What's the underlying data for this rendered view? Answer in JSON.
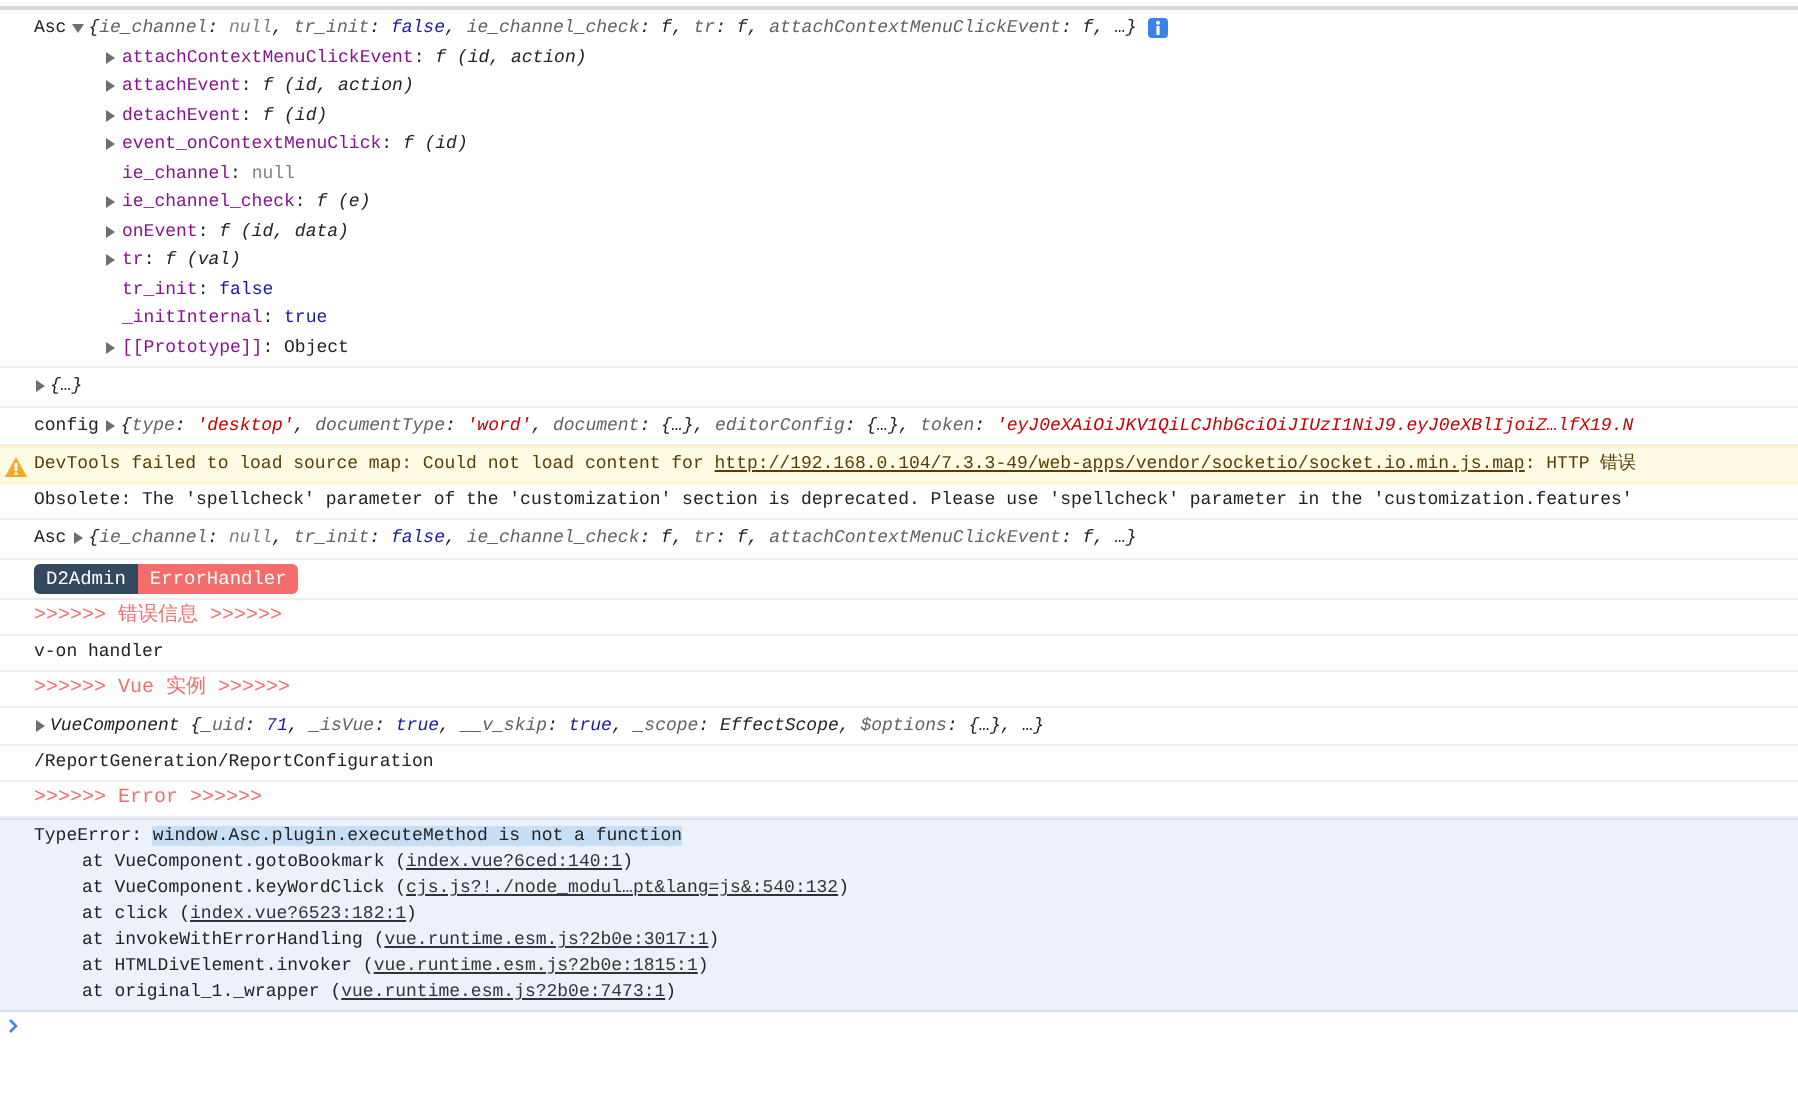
{
  "messages": [
    {
      "kind": "object",
      "label": "Asc",
      "expanded": true,
      "info_icon": true,
      "preview": [
        {
          "kind": "plain",
          "text": "{"
        },
        {
          "kind": "pkey",
          "text": "ie_channel"
        },
        {
          "kind": "plain",
          "text": ": "
        },
        {
          "kind": "null",
          "text": "null"
        },
        {
          "kind": "plain",
          "text": ", "
        },
        {
          "kind": "pkey",
          "text": "tr_init"
        },
        {
          "kind": "plain",
          "text": ": "
        },
        {
          "kind": "bool",
          "text": "false"
        },
        {
          "kind": "plain",
          "text": ", "
        },
        {
          "kind": "pkey",
          "text": "ie_channel_check"
        },
        {
          "kind": "plain",
          "text": ": "
        },
        {
          "kind": "fn",
          "text": "f"
        },
        {
          "kind": "plain",
          "text": ", "
        },
        {
          "kind": "pkey",
          "text": "tr"
        },
        {
          "kind": "plain",
          "text": ": "
        },
        {
          "kind": "fn",
          "text": "f"
        },
        {
          "kind": "plain",
          "text": ", "
        },
        {
          "kind": "pkey",
          "text": "attachContextMenuClickEvent"
        },
        {
          "kind": "plain",
          "text": ": "
        },
        {
          "kind": "fn",
          "text": "f"
        },
        {
          "kind": "plain",
          "text": ", …}"
        }
      ],
      "properties": [
        {
          "expandable": true,
          "parts": [
            {
              "kind": "key",
              "text": "attachContextMenuClickEvent"
            },
            {
              "kind": "plain",
              "text": ": "
            },
            {
              "kind": "fn",
              "text": "f (id, action)"
            }
          ]
        },
        {
          "expandable": true,
          "parts": [
            {
              "kind": "key",
              "text": "attachEvent"
            },
            {
              "kind": "plain",
              "text": ": "
            },
            {
              "kind": "fn",
              "text": "f (id, action)"
            }
          ]
        },
        {
          "expandable": true,
          "parts": [
            {
              "kind": "key",
              "text": "detachEvent"
            },
            {
              "kind": "plain",
              "text": ": "
            },
            {
              "kind": "fn",
              "text": "f (id)"
            }
          ]
        },
        {
          "expandable": true,
          "parts": [
            {
              "kind": "key",
              "text": "event_onContextMenuClick"
            },
            {
              "kind": "plain",
              "text": ": "
            },
            {
              "kind": "fn",
              "text": "f (id)"
            }
          ]
        },
        {
          "expandable": false,
          "parts": [
            {
              "kind": "key",
              "text": "ie_channel"
            },
            {
              "kind": "plain",
              "text": ": "
            },
            {
              "kind": "null",
              "text": "null"
            }
          ]
        },
        {
          "expandable": true,
          "parts": [
            {
              "kind": "key",
              "text": "ie_channel_check"
            },
            {
              "kind": "plain",
              "text": ": "
            },
            {
              "kind": "fn",
              "text": "f (e)"
            }
          ]
        },
        {
          "expandable": true,
          "parts": [
            {
              "kind": "key",
              "text": "onEvent"
            },
            {
              "kind": "plain",
              "text": ": "
            },
            {
              "kind": "fn",
              "text": "f (id, data)"
            }
          ]
        },
        {
          "expandable": true,
          "parts": [
            {
              "kind": "key",
              "text": "tr"
            },
            {
              "kind": "plain",
              "text": ": "
            },
            {
              "kind": "fn",
              "text": "f (val)"
            }
          ]
        },
        {
          "expandable": false,
          "parts": [
            {
              "kind": "key",
              "text": "tr_init"
            },
            {
              "kind": "plain",
              "text": ": "
            },
            {
              "kind": "bool",
              "text": "false"
            }
          ]
        },
        {
          "expandable": false,
          "parts": [
            {
              "kind": "key",
              "text": "_initInternal"
            },
            {
              "kind": "plain",
              "text": ": "
            },
            {
              "kind": "bool",
              "text": "true"
            }
          ]
        },
        {
          "expandable": true,
          "parts": [
            {
              "kind": "key",
              "text": "[[Prototype]]"
            },
            {
              "kind": "plain",
              "text": ": "
            },
            {
              "kind": "plain",
              "text": "Object"
            }
          ]
        }
      ]
    },
    {
      "kind": "object",
      "expanded": false,
      "preview": [
        {
          "kind": "plain",
          "text": "{…}"
        }
      ]
    },
    {
      "kind": "object",
      "label": "config",
      "expanded": false,
      "preview": [
        {
          "kind": "plain",
          "text": "{"
        },
        {
          "kind": "pkey",
          "text": "type"
        },
        {
          "kind": "plain",
          "text": ": "
        },
        {
          "kind": "str",
          "text": "'desktop'"
        },
        {
          "kind": "plain",
          "text": ", "
        },
        {
          "kind": "pkey",
          "text": "documentType"
        },
        {
          "kind": "plain",
          "text": ": "
        },
        {
          "kind": "str",
          "text": "'word'"
        },
        {
          "kind": "plain",
          "text": ", "
        },
        {
          "kind": "pkey",
          "text": "document"
        },
        {
          "kind": "plain",
          "text": ": {…}, "
        },
        {
          "kind": "pkey",
          "text": "editorConfig"
        },
        {
          "kind": "plain",
          "text": ": {…}, "
        },
        {
          "kind": "pkey",
          "text": "token"
        },
        {
          "kind": "plain",
          "text": ": "
        },
        {
          "kind": "str",
          "text": "'eyJ0eXAiOiJKV1QiLCJhbGciOiJIUzI1NiJ9.eyJ0eXBlIjoiZ…lfX19.N"
        }
      ]
    },
    {
      "kind": "warning",
      "parts": [
        {
          "kind": "plain",
          "text": "DevTools failed to load source map: Could not load content for "
        },
        {
          "kind": "link",
          "text": "http://192.168.0.104/7.3.3-49/web-apps/vendor/socketio/socket.io.min.js.map"
        },
        {
          "kind": "plain",
          "text": ": HTTP 错误"
        }
      ]
    },
    {
      "kind": "text",
      "parts": [
        {
          "kind": "plain",
          "text": "Obsolete: The 'spellcheck' parameter of the 'customization' section is deprecated. Please use 'spellcheck' parameter in the 'customization.features'"
        }
      ]
    },
    {
      "kind": "object",
      "label": "Asc",
      "expanded": false,
      "preview": [
        {
          "kind": "plain",
          "text": "{"
        },
        {
          "kind": "pkey",
          "text": "ie_channel"
        },
        {
          "kind": "plain",
          "text": ": "
        },
        {
          "kind": "null",
          "text": "null"
        },
        {
          "kind": "plain",
          "text": ", "
        },
        {
          "kind": "pkey",
          "text": "tr_init"
        },
        {
          "kind": "plain",
          "text": ": "
        },
        {
          "kind": "bool",
          "text": "false"
        },
        {
          "kind": "plain",
          "text": ", "
        },
        {
          "kind": "pkey",
          "text": "ie_channel_check"
        },
        {
          "kind": "plain",
          "text": ": "
        },
        {
          "kind": "fn",
          "text": "f"
        },
        {
          "kind": "plain",
          "text": ", "
        },
        {
          "kind": "pkey",
          "text": "tr"
        },
        {
          "kind": "plain",
          "text": ": "
        },
        {
          "kind": "fn",
          "text": "f"
        },
        {
          "kind": "plain",
          "text": ", "
        },
        {
          "kind": "pkey",
          "text": "attachContextMenuClickEvent"
        },
        {
          "kind": "plain",
          "text": ": "
        },
        {
          "kind": "fn",
          "text": "f"
        },
        {
          "kind": "plain",
          "text": ", …}"
        }
      ]
    },
    {
      "kind": "badges",
      "badges": [
        {
          "text": "D2Admin",
          "color": "#35495e"
        },
        {
          "text": "ErrorHandler",
          "color": "#f56c6c"
        }
      ]
    },
    {
      "kind": "text",
      "parts": [
        {
          "kind": "accent",
          "text": ">>>>>> 错误信息 >>>>>>"
        }
      ]
    },
    {
      "kind": "text",
      "parts": [
        {
          "kind": "plain",
          "text": "v-on handler"
        }
      ]
    },
    {
      "kind": "text",
      "parts": [
        {
          "kind": "accent",
          "text": ">>>>>> Vue 实例 >>>>>>"
        }
      ]
    },
    {
      "kind": "object",
      "expanded": false,
      "preview": [
        {
          "kind": "plain",
          "text": "VueComponent {"
        },
        {
          "kind": "pkey",
          "text": "_uid"
        },
        {
          "kind": "plain",
          "text": ": "
        },
        {
          "kind": "num",
          "text": "71"
        },
        {
          "kind": "plain",
          "text": ", "
        },
        {
          "kind": "pkey",
          "text": "_isVue"
        },
        {
          "kind": "plain",
          "text": ": "
        },
        {
          "kind": "bool",
          "text": "true"
        },
        {
          "kind": "plain",
          "text": ", "
        },
        {
          "kind": "pkey",
          "text": "__v_skip"
        },
        {
          "kind": "plain",
          "text": ": "
        },
        {
          "kind": "bool",
          "text": "true"
        },
        {
          "kind": "plain",
          "text": ", "
        },
        {
          "kind": "pkey",
          "text": "_scope"
        },
        {
          "kind": "plain",
          "text": ": EffectScope, "
        },
        {
          "kind": "pkey",
          "text": "$options"
        },
        {
          "kind": "plain",
          "text": ": {…}, …}"
        }
      ]
    },
    {
      "kind": "text",
      "parts": [
        {
          "kind": "plain",
          "text": "/ReportGeneration/ReportConfiguration"
        }
      ]
    },
    {
      "kind": "text",
      "parts": [
        {
          "kind": "accent",
          "text": ">>>>>> Error >>>>>>"
        }
      ]
    },
    {
      "kind": "error",
      "parts": [
        {
          "kind": "plain",
          "text": "TypeError: "
        },
        {
          "kind": "highlight",
          "text": "window.Asc.plugin.executeMethod is not a function"
        }
      ],
      "stack": [
        [
          {
            "kind": "plain",
            "text": "at VueComponent.gotoBookmark ("
          },
          {
            "kind": "link",
            "text": "index.vue?6ced:140:1"
          },
          {
            "kind": "plain",
            "text": ")"
          }
        ],
        [
          {
            "kind": "plain",
            "text": "at VueComponent.keyWordClick ("
          },
          {
            "kind": "link",
            "text": "cjs.js?!./node_modul…pt&lang=js&:540:132"
          },
          {
            "kind": "plain",
            "text": ")"
          }
        ],
        [
          {
            "kind": "plain",
            "text": "at click ("
          },
          {
            "kind": "link",
            "text": "index.vue?6523:182:1"
          },
          {
            "kind": "plain",
            "text": ")"
          }
        ],
        [
          {
            "kind": "plain",
            "text": "at invokeWithErrorHandling ("
          },
          {
            "kind": "link",
            "text": "vue.runtime.esm.js?2b0e:3017:1"
          },
          {
            "kind": "plain",
            "text": ")"
          }
        ],
        [
          {
            "kind": "plain",
            "text": "at HTMLDivElement.invoker ("
          },
          {
            "kind": "link",
            "text": "vue.runtime.esm.js?2b0e:1815:1"
          },
          {
            "kind": "plain",
            "text": ")"
          }
        ],
        [
          {
            "kind": "plain",
            "text": "at original_1._wrapper ("
          },
          {
            "kind": "link",
            "text": "vue.runtime.esm.js?2b0e:7473:1"
          },
          {
            "kind": "plain",
            "text": ")"
          }
        ]
      ]
    }
  ]
}
